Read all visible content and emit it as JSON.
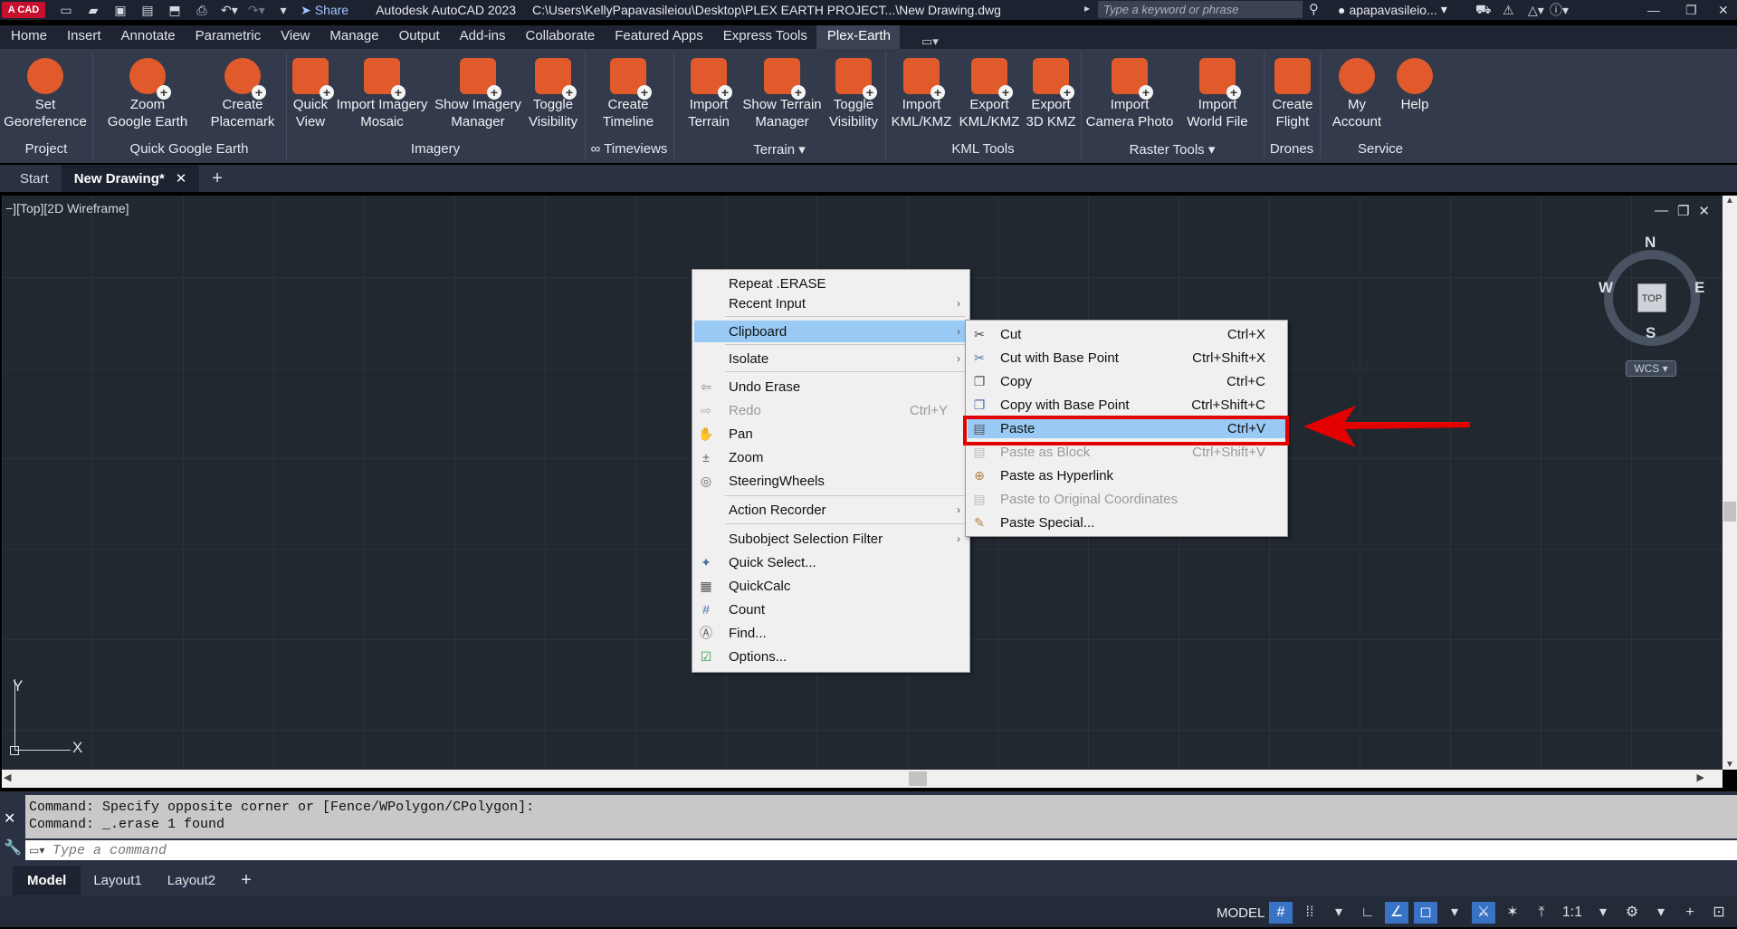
{
  "titlebar": {
    "logo": "A CAD",
    "share_label": "Share",
    "app_title": "Autodesk AutoCAD 2023",
    "file_path": "C:\\Users\\KellyPapavasileiou\\Desktop\\PLEX EARTH PROJECT...\\New Drawing.dwg",
    "search_placeholder": "Type a keyword or phrase",
    "user_name": "apapavasileio..."
  },
  "ribbon_tabs": [
    "Home",
    "Insert",
    "Annotate",
    "Parametric",
    "View",
    "Manage",
    "Output",
    "Add-ins",
    "Collaborate",
    "Featured Apps",
    "Express Tools",
    "Plex-Earth"
  ],
  "active_ribbon_tab": "Plex-Earth",
  "ribbon": {
    "buttons": [
      {
        "line1": "Set",
        "line2": "Georeference"
      },
      {
        "line1": "Zoom",
        "line2": "Google Earth"
      },
      {
        "line1": "Create",
        "line2": "Placemark"
      },
      {
        "line1": "Quick",
        "line2": "View"
      },
      {
        "line1": "Import Imagery",
        "line2": "Mosaic"
      },
      {
        "line1": "Show Imagery",
        "line2": "Manager"
      },
      {
        "line1": "Toggle",
        "line2": "Visibility"
      },
      {
        "line1": "Create",
        "line2": "Timeline"
      },
      {
        "line1": "Import",
        "line2": "Terrain"
      },
      {
        "line1": "Show Terrain",
        "line2": "Manager"
      },
      {
        "line1": "Toggle",
        "line2": "Visibility"
      },
      {
        "line1": "Import",
        "line2": "KML/KMZ"
      },
      {
        "line1": "Export",
        "line2": "KML/KMZ"
      },
      {
        "line1": "Export",
        "line2": "3D KMZ"
      },
      {
        "line1": "Import",
        "line2": "Camera Photo"
      },
      {
        "line1": "Import",
        "line2": "World File"
      },
      {
        "line1": "Create",
        "line2": "Flight"
      },
      {
        "line1": "My",
        "line2": "Account"
      },
      {
        "line1": "Help",
        "line2": ""
      }
    ],
    "panels": [
      "Project",
      "Quick Google Earth",
      "Imagery",
      "∞ Timeviews",
      "Terrain ▾",
      "KML Tools",
      "Raster Tools ▾",
      "Drones",
      "Service"
    ]
  },
  "doc_tabs": {
    "start": "Start",
    "active": "New Drawing*",
    "new": "+"
  },
  "viewport": {
    "label": "−][Top][2D Wireframe]",
    "viewcube": {
      "top": "TOP",
      "n": "N",
      "s": "S",
      "e": "E",
      "w": "W"
    },
    "wcs": "WCS ▾",
    "ucs": {
      "x": "X",
      "y": "Y"
    }
  },
  "context_menu": {
    "items": [
      {
        "label": "Repeat .ERASE",
        "shortcut": "",
        "arrow": ""
      },
      {
        "label": "Recent Input",
        "shortcut": "",
        "arrow": "›"
      },
      {
        "label": "Clipboard",
        "shortcut": "",
        "arrow": "›"
      },
      {
        "label": "Isolate",
        "shortcut": "",
        "arrow": "›"
      },
      {
        "label": "Undo Erase",
        "shortcut": "",
        "arrow": ""
      },
      {
        "label": "Redo",
        "shortcut": "Ctrl+Y",
        "arrow": ""
      },
      {
        "label": "Pan",
        "shortcut": "",
        "arrow": ""
      },
      {
        "label": "Zoom",
        "shortcut": "",
        "arrow": ""
      },
      {
        "label": "SteeringWheels",
        "shortcut": "",
        "arrow": ""
      },
      {
        "label": "Action Recorder",
        "shortcut": "",
        "arrow": "›"
      },
      {
        "label": "Subobject Selection Filter",
        "shortcut": "",
        "arrow": "›"
      },
      {
        "label": "Quick Select...",
        "shortcut": "",
        "arrow": ""
      },
      {
        "label": "QuickCalc",
        "shortcut": "",
        "arrow": ""
      },
      {
        "label": "Count",
        "shortcut": "",
        "arrow": ""
      },
      {
        "label": "Find...",
        "shortcut": "",
        "arrow": ""
      },
      {
        "label": "Options...",
        "shortcut": "",
        "arrow": ""
      }
    ]
  },
  "clipboard_submenu": {
    "items": [
      {
        "label": "Cut",
        "shortcut": "Ctrl+X"
      },
      {
        "label": "Cut with Base Point",
        "shortcut": "Ctrl+Shift+X"
      },
      {
        "label": "Copy",
        "shortcut": "Ctrl+C"
      },
      {
        "label": "Copy with Base Point",
        "shortcut": "Ctrl+Shift+C"
      },
      {
        "label": "Paste",
        "shortcut": "Ctrl+V"
      },
      {
        "label": "Paste as Block",
        "shortcut": "Ctrl+Shift+V"
      },
      {
        "label": "Paste as Hyperlink",
        "shortcut": ""
      },
      {
        "label": "Paste to Original Coordinates",
        "shortcut": ""
      },
      {
        "label": "Paste Special...",
        "shortcut": ""
      }
    ]
  },
  "command_line": {
    "history_1": "Command: Specify opposite corner or [Fence/WPolygon/CPolygon]:",
    "history_2": "Command: _.erase 1 found",
    "placeholder": "Type a command"
  },
  "layout_tabs": {
    "model": "Model",
    "layout1": "Layout1",
    "layout2": "Layout2",
    "add": "+"
  },
  "statusbar": {
    "model": "MODEL",
    "scale": "1:1"
  },
  "colors": {
    "accent_orange": "#e05a2b",
    "highlight": "#99c9f5",
    "annotation_red": "#e30000",
    "active_blue": "#3973c6"
  }
}
